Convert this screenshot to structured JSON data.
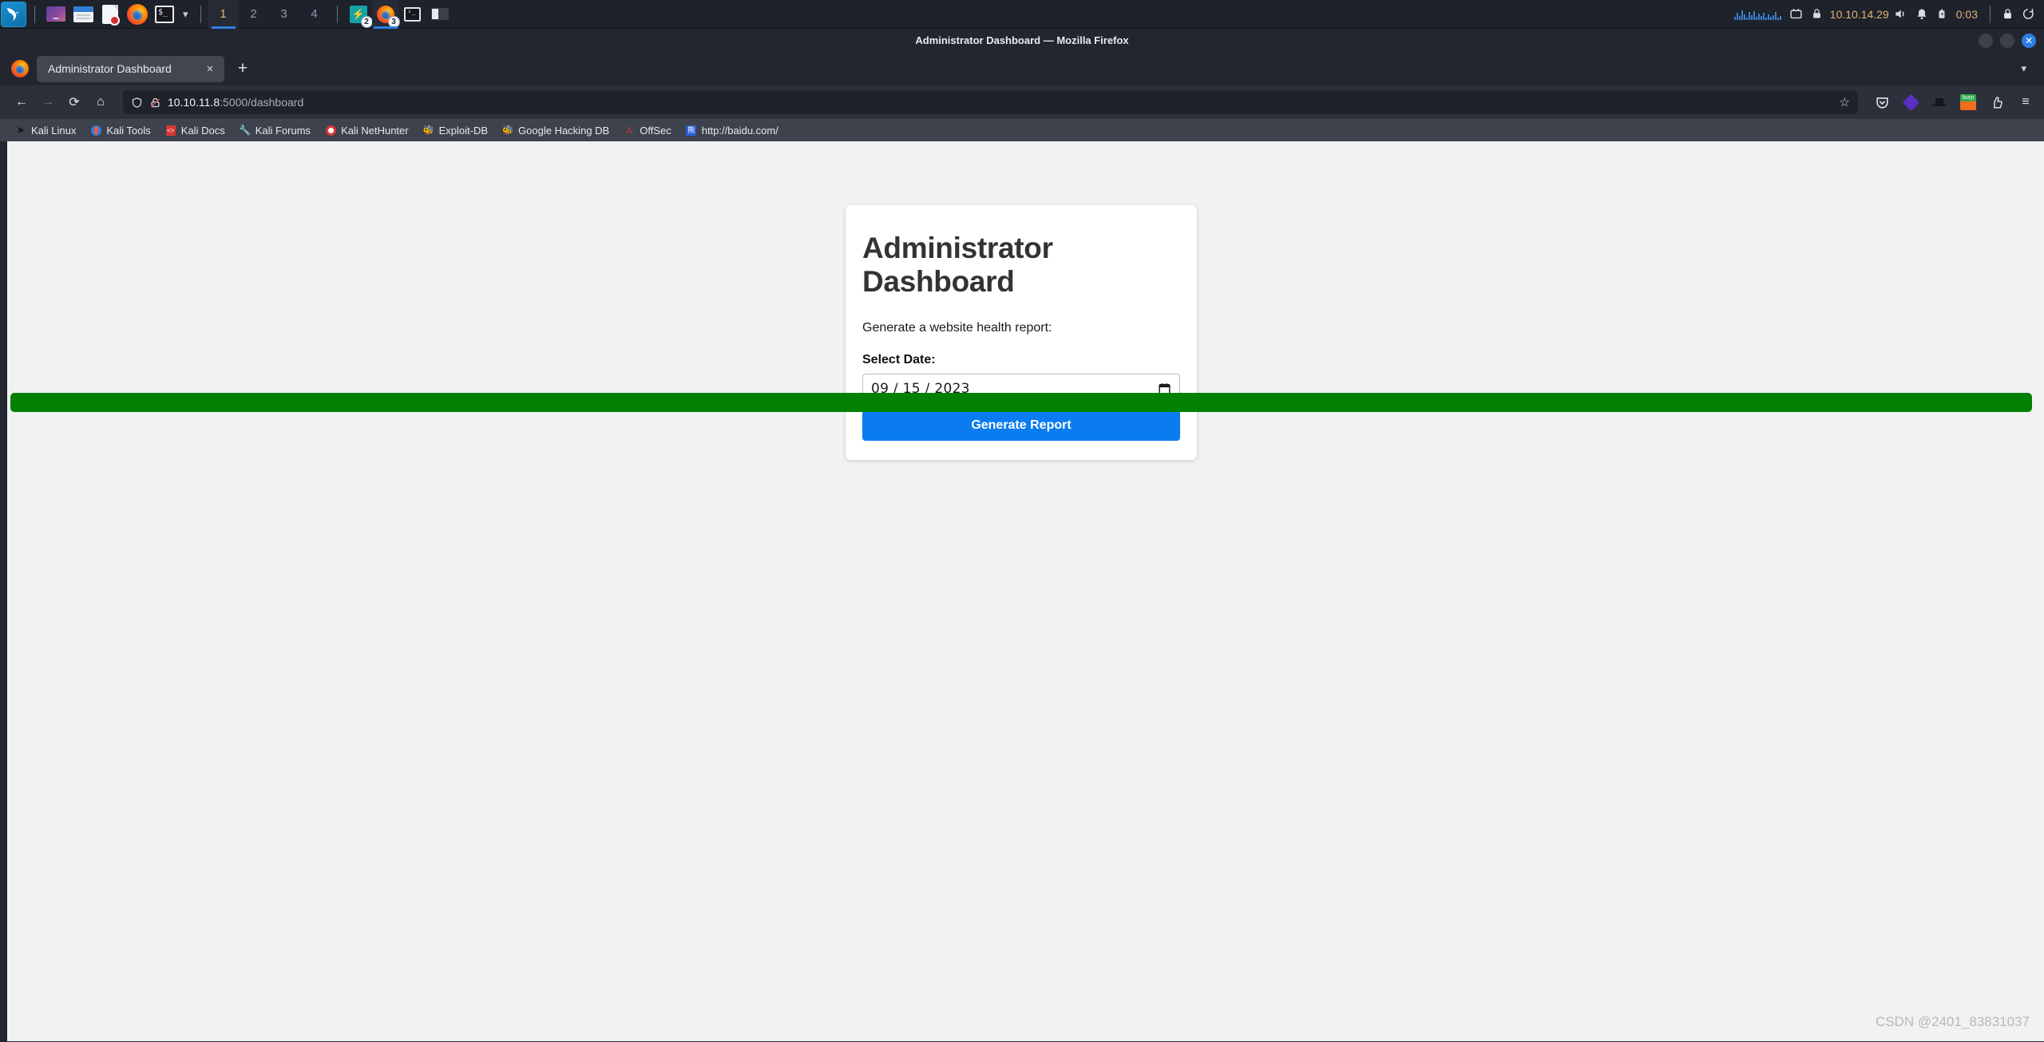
{
  "taskbar": {
    "launchers": [
      {
        "name": "kali-menu",
        "label": "Kali Menu"
      },
      {
        "name": "kali-apps",
        "label": "Applications"
      },
      {
        "name": "file-manager",
        "label": "Files"
      },
      {
        "name": "text-editor",
        "label": "Text Editor"
      },
      {
        "name": "firefox",
        "label": "Firefox ESR"
      },
      {
        "name": "terminal",
        "label": "Terminal"
      }
    ],
    "workspaces": [
      "1",
      "2",
      "3",
      "4"
    ],
    "active_workspace": "1",
    "windows": [
      {
        "name": "app-window",
        "badge": "2"
      },
      {
        "name": "firefox-window",
        "badge": "3",
        "active": true
      },
      {
        "name": "terminal-window",
        "badge": ""
      },
      {
        "name": "misc-window",
        "badge": ""
      }
    ],
    "tray": {
      "vpn_ip": "10.10.14.29",
      "clock": "0:03",
      "icons": [
        "network-icon",
        "vpn-lock-icon",
        "volume-icon",
        "bell-icon",
        "battery-icon",
        "lock-icon",
        "power-icon"
      ]
    }
  },
  "window": {
    "title": "Administrator Dashboard — Mozilla Firefox",
    "controls": [
      "minimize",
      "maximize",
      "close"
    ]
  },
  "tabs": {
    "items": [
      {
        "title": "Administrator Dashboard",
        "close": "×"
      }
    ],
    "new_tab": "+",
    "list_all": "⌄"
  },
  "navbar": {
    "back": "←",
    "forward": "→",
    "reload": "⟳",
    "home": "⌂",
    "url_host": "10.10.11.8",
    "url_path": ":5000/dashboard",
    "star": "☆",
    "extensions": [
      "pocket-icon",
      "foxyproxy-icon",
      "hacktools-icon",
      "burpsuite-icon",
      "extensions-icon"
    ],
    "menu": "≡"
  },
  "bookmarks": [
    {
      "label": "Kali Linux",
      "icon": "kali-dragon-icon"
    },
    {
      "label": "Kali Tools",
      "icon": "kali-tools-icon"
    },
    {
      "label": "Kali Docs",
      "icon": "kali-docs-icon"
    },
    {
      "label": "Kali Forums",
      "icon": "kali-forums-icon"
    },
    {
      "label": "Kali NetHunter",
      "icon": "kali-nethunter-icon"
    },
    {
      "label": "Exploit-DB",
      "icon": "exploit-db-icon"
    },
    {
      "label": "Google Hacking DB",
      "icon": "google-hacking-db-icon"
    },
    {
      "label": "OffSec",
      "icon": "offsec-icon"
    },
    {
      "label": "http://baidu.com/",
      "icon": "baidu-icon"
    }
  ],
  "page": {
    "heading": "Administrator Dashboard",
    "subtitle": "Generate a website health report:",
    "date_label": "Select Date:",
    "date_value": "09 / 15 / 2023",
    "submit_label": "Generate Report",
    "alert_text": "",
    "accent_color": "#0a7cf0",
    "alert_color": "#018001",
    "watermark": "CSDN @2401_83831037"
  }
}
